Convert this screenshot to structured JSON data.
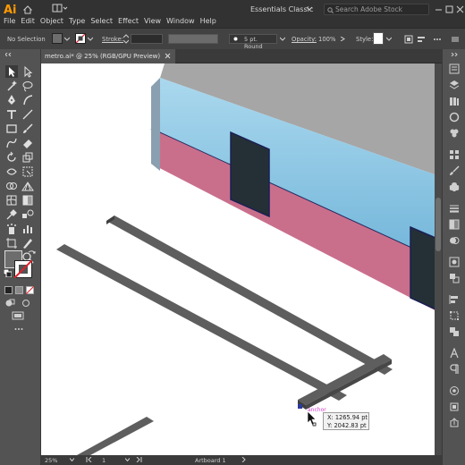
{
  "app": {
    "logo": "Ai"
  },
  "menu": {
    "items": [
      "File",
      "Edit",
      "Object",
      "Type",
      "Select",
      "Effect",
      "View",
      "Window",
      "Help"
    ]
  },
  "workspace": {
    "label": "Essentials Classic"
  },
  "search": {
    "placeholder": "Search Adobe Stock"
  },
  "control_bar": {
    "selection": "No Selection",
    "stroke_label": "Stroke:",
    "brush": "5 pt. Round",
    "opacity_label": "Opacity:",
    "opacity_value": "100%",
    "style_label": "Style:"
  },
  "document": {
    "tab_title": "metro.ai* @ 25% (RGB/GPU Preview)"
  },
  "status": {
    "zoom": "25%",
    "artboard_number": "1",
    "tool_name": "Artboard 1"
  },
  "pointer": {
    "label": "anchor",
    "x_readout": "X: 1265.94 pt",
    "y_readout": "Y: 2042.83 pt"
  },
  "colors": {
    "accent": "#ff9a00",
    "train_blue": "#8ec9e6",
    "train_pink": "#c96f8c",
    "train_roof": "#a6a6a6",
    "door": "#243036",
    "rail": "#5e5e5e",
    "smart_guide": "#d23fd2"
  },
  "tool_icons": [
    "selection-tool",
    "direct-selection-tool",
    "magic-wand-tool",
    "lasso-tool",
    "pen-tool",
    "curvature-tool",
    "type-tool",
    "line-tool",
    "rectangle-tool",
    "paintbrush-tool",
    "shaper-tool",
    "eraser-tool",
    "rotate-tool",
    "scale-tool",
    "width-tool",
    "free-transform-tool",
    "shape-builder-tool",
    "perspective-grid-tool",
    "mesh-tool",
    "gradient-tool",
    "eyedropper-tool",
    "blend-tool",
    "symbol-sprayer-tool",
    "column-graph-tool",
    "artboard-tool",
    "slice-tool",
    "hand-tool",
    "zoom-tool"
  ],
  "dock_icons": [
    "properties-icon",
    "layers-icon",
    "libraries-icon",
    "color-icon",
    "color-guide-icon",
    "swatches-icon",
    "brushes-icon",
    "symbols-icon",
    "stroke-icon",
    "gradient-icon",
    "transparency-icon",
    "appearance-icon",
    "graphic-styles-icon",
    "align-icon",
    "transform-icon",
    "pathfinder-icon",
    "character-icon",
    "paragraph-icon",
    "links-icon"
  ]
}
